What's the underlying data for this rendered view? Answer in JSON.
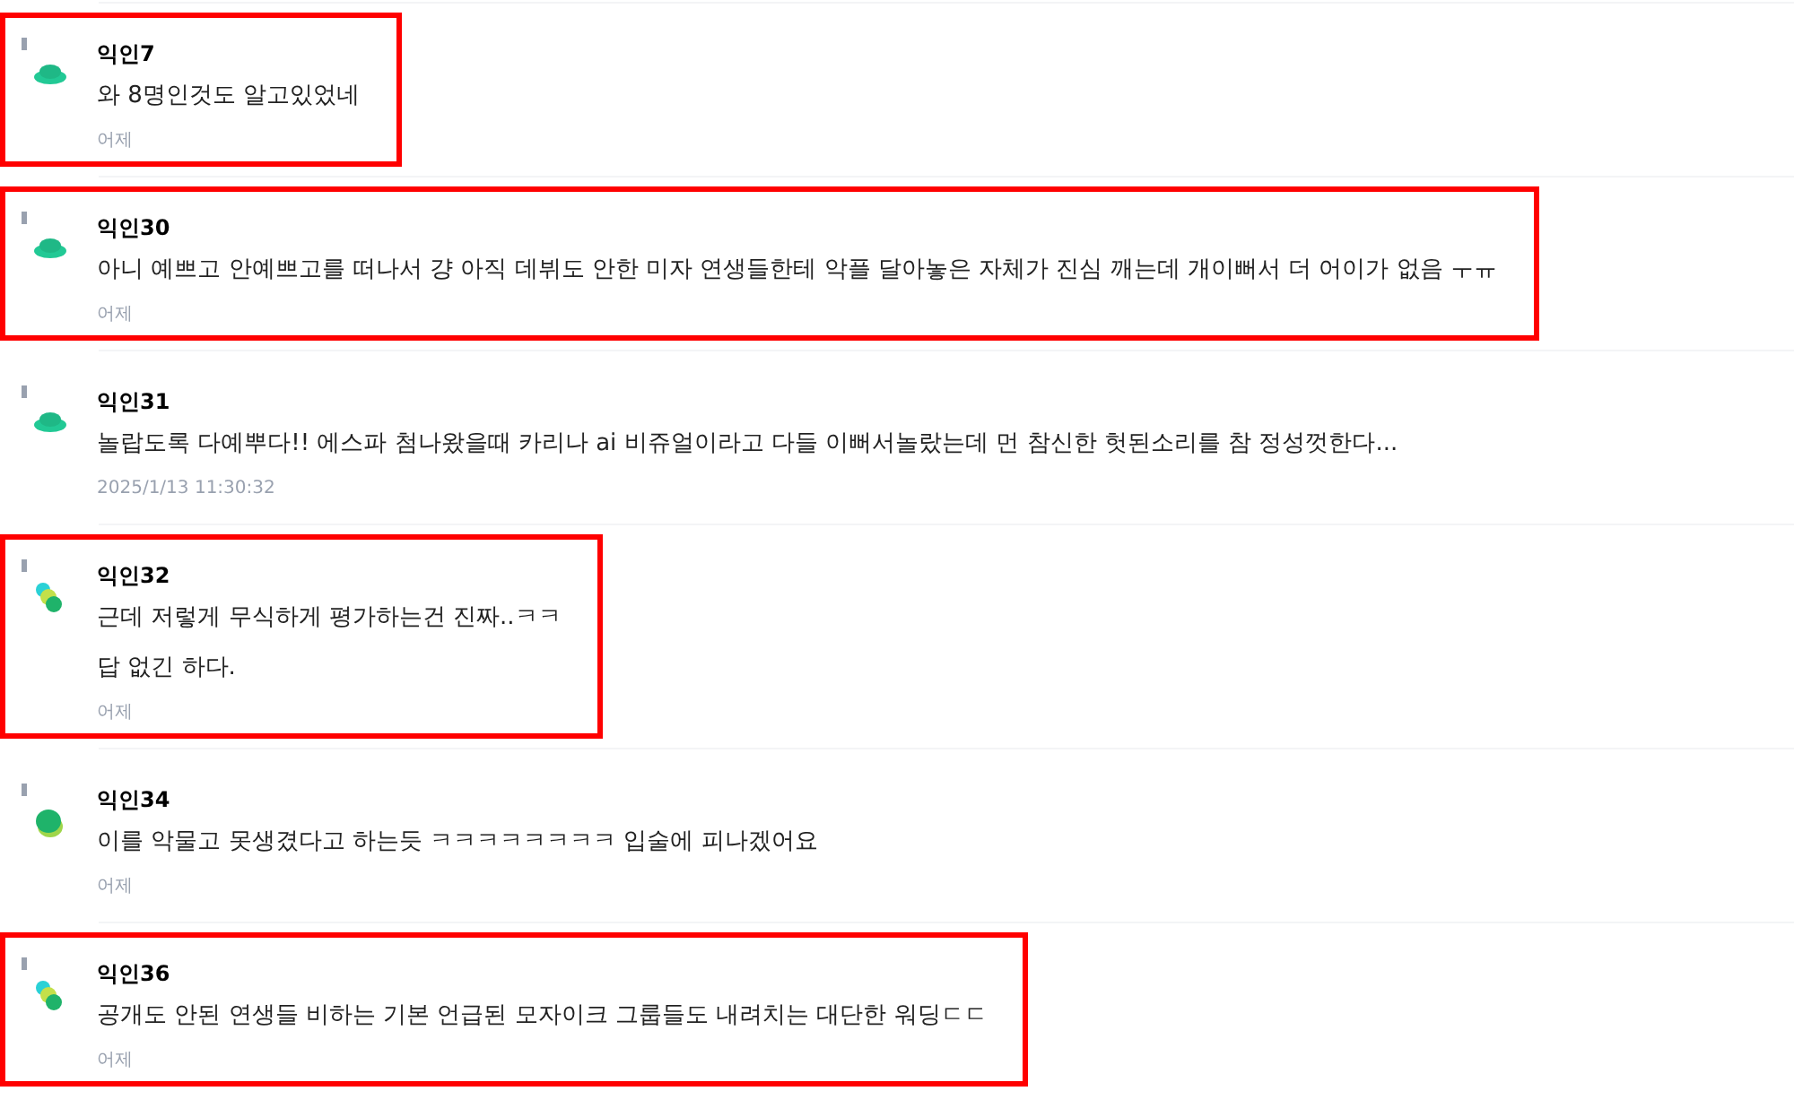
{
  "comments": [
    {
      "author": "익인7",
      "avatar": {
        "kind": "hat"
      },
      "lines": [
        "와 8명인것도 알고있었네"
      ],
      "time": "어제",
      "highlighted": true
    },
    {
      "author": "익인30",
      "avatar": {
        "kind": "hat"
      },
      "lines": [
        "아니 예쁘고 안예쁘고를 떠나서 걍 아직 데뷔도 안한 미자 연생들한테 악플 달아놓은 자체가 진심 깨는데 개이뻐서 더 어이가 없음 ㅜㅠ"
      ],
      "time": "어제",
      "highlighted": true
    },
    {
      "author": "익인31",
      "avatar": {
        "kind": "hat"
      },
      "lines": [
        "놀랍도록 다예뿌다!! 에스파 첨나왔을때 카리나 ai 비쥬얼이라고 다들 이뻐서놀랐는데 먼 참신한 헛된소리를 참 정성껏한다..."
      ],
      "time": "2025/1/13 11:30:32",
      "highlighted": false
    },
    {
      "author": "익인32",
      "avatar": {
        "kind": "dots"
      },
      "lines": [
        "근데 저렇게 무식하게 평가하는건 진짜..ㅋㅋ",
        "답 없긴 하다."
      ],
      "time": "어제",
      "highlighted": true
    },
    {
      "author": "익인34",
      "avatar": {
        "kind": "blob"
      },
      "lines": [
        "이를 악물고 못생겼다고 하는듯 ㅋㅋㅋㅋㅋㅋㅋㅋ 입술에 피나겠어요"
      ],
      "time": "어제",
      "highlighted": false
    },
    {
      "author": "익인36",
      "avatar": {
        "kind": "dots"
      },
      "lines": [
        "공개도 안된 연생들 비하는 기본 언급된 모자이크 그룹들도 내려치는 대단한 워딩ㄷㄷ"
      ],
      "time": "어제",
      "highlighted": true
    }
  ]
}
